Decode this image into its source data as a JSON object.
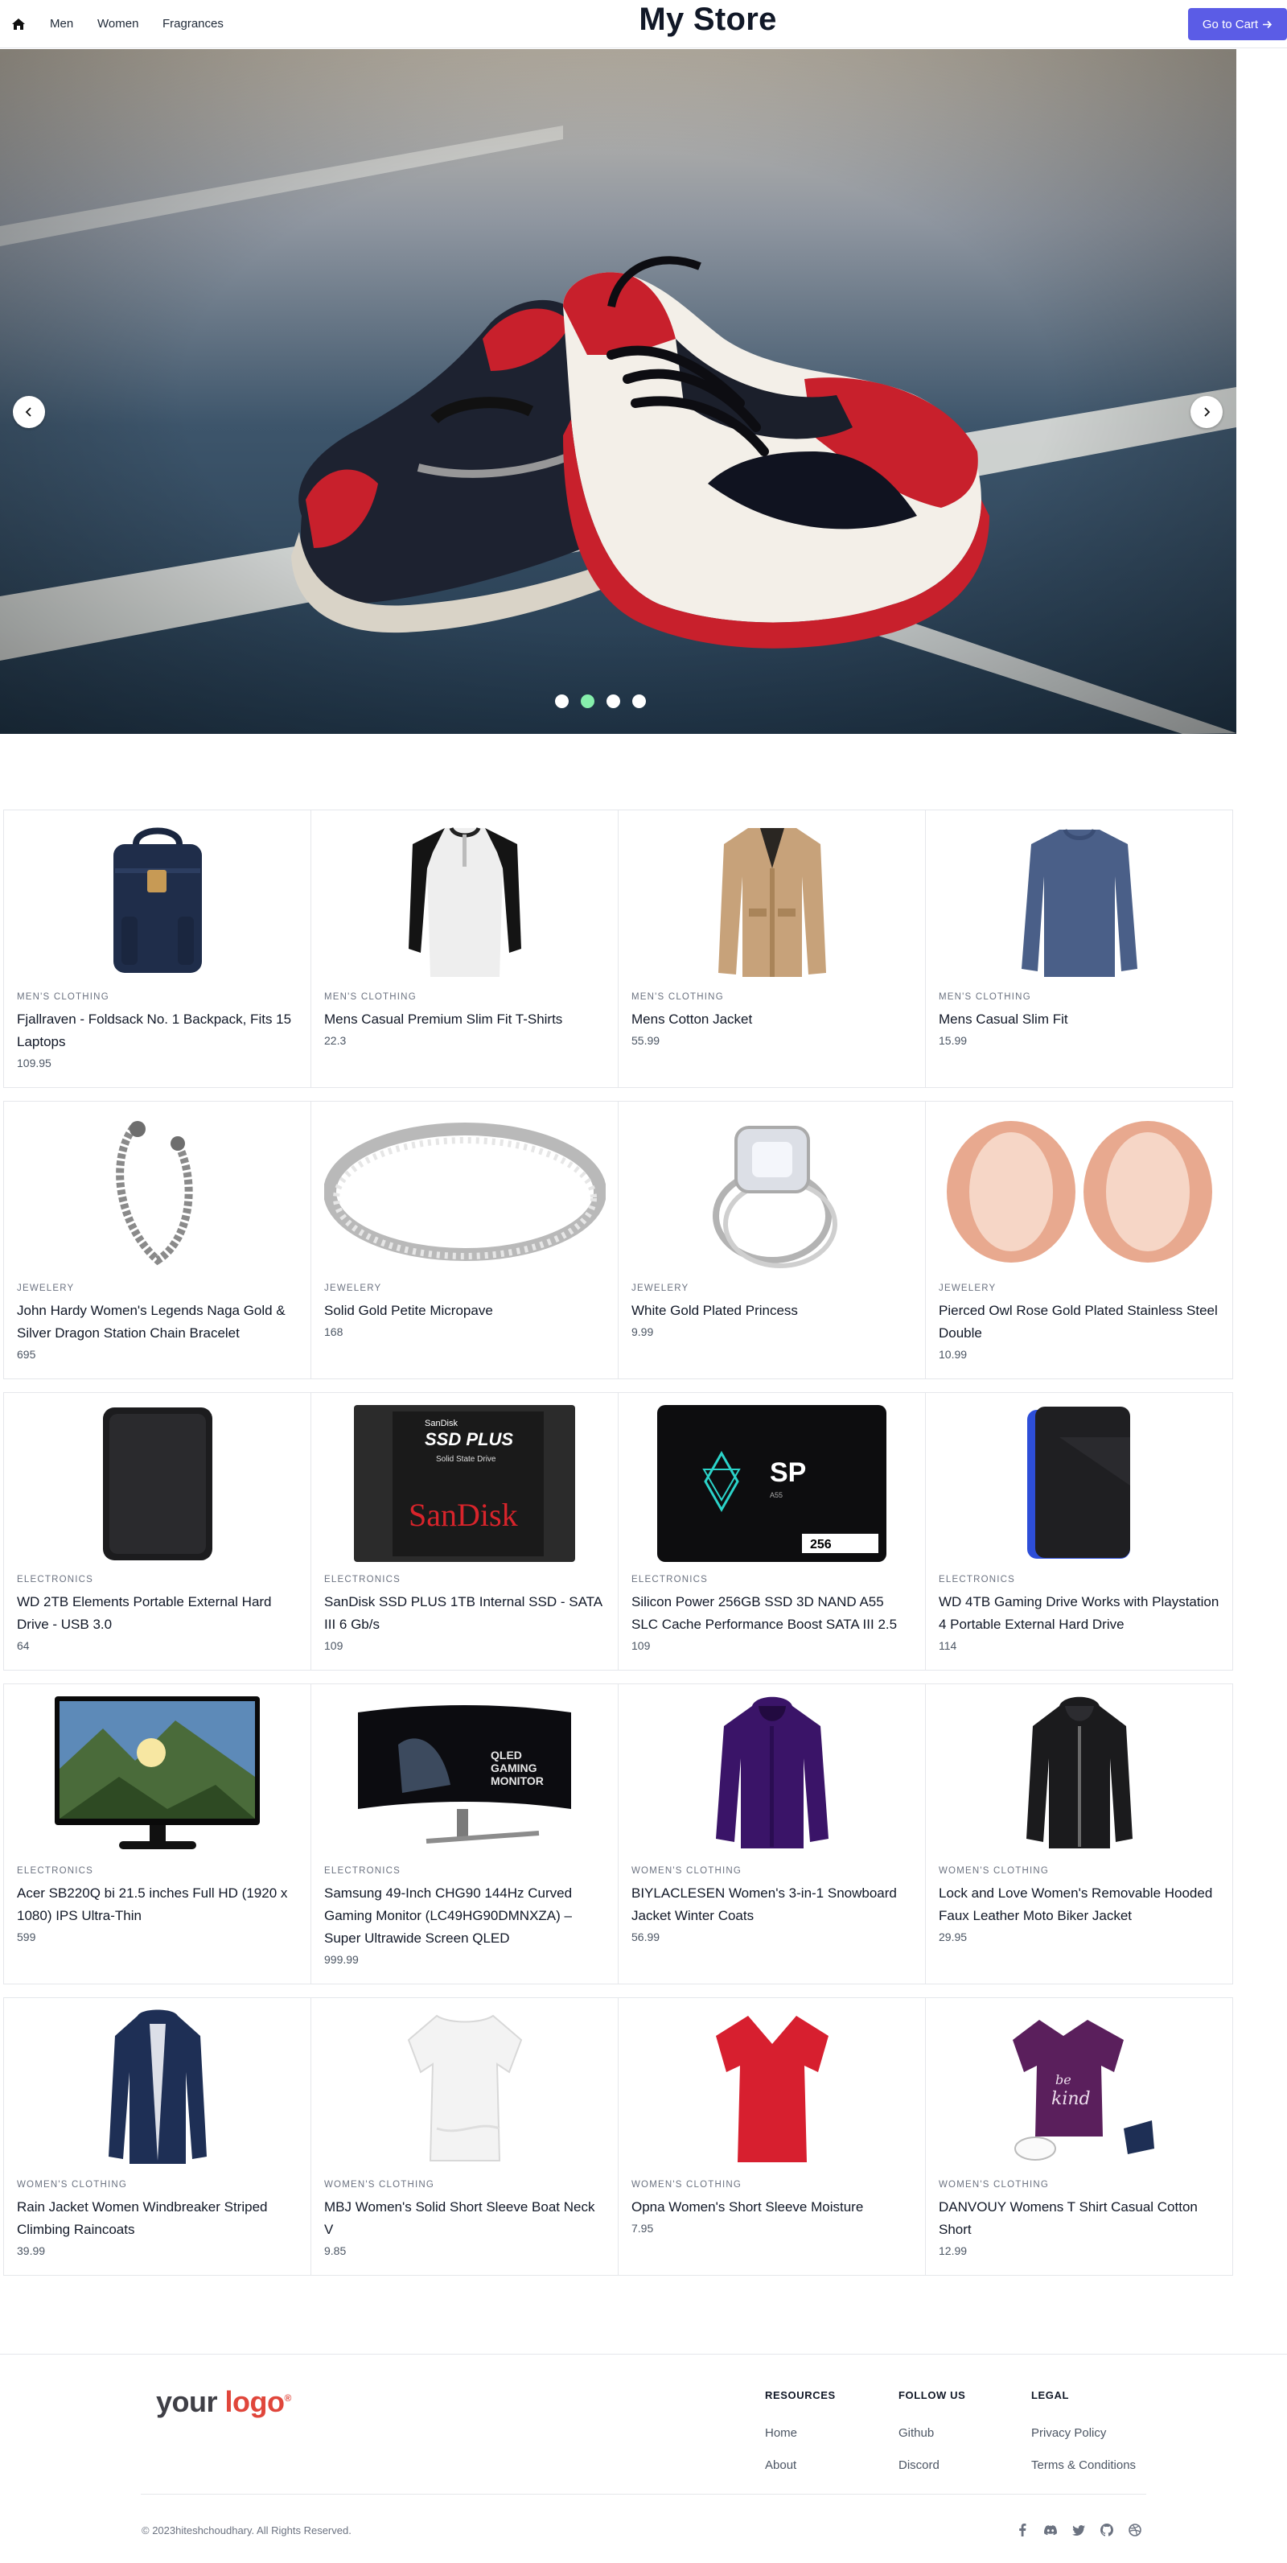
{
  "nav": {
    "home_icon": "home-icon",
    "links": [
      "Men",
      "Women",
      "Fragrances"
    ],
    "title": "My Store",
    "cart_label": "Go to Cart",
    "cart_icon": "arrow-right-icon",
    "accent": "#5b5ce6"
  },
  "hero": {
    "slide_count": 4,
    "active_slide": 2,
    "prev_icon": "chevron-left-icon",
    "next_icon": "chevron-right-icon",
    "active_dot_color": "#86efac"
  },
  "products": [
    {
      "category": "men's clothing",
      "title": "Fjallraven - Foldsack No. 1 Backpack, Fits 15 Laptops",
      "price": "109.95",
      "icon": "backpack"
    },
    {
      "category": "men's clothing",
      "title": "Mens Casual Premium Slim Fit T-Shirts",
      "price": "22.3",
      "icon": "raglan-tshirt"
    },
    {
      "category": "men's clothing",
      "title": "Mens Cotton Jacket",
      "price": "55.99",
      "icon": "cotton-jacket"
    },
    {
      "category": "men's clothing",
      "title": "Mens Casual Slim Fit",
      "price": "15.99",
      "icon": "long-sleeve-shirt"
    },
    {
      "category": "jewelery",
      "title": "John Hardy Women's Legends Naga Gold & Silver Dragon Station Chain Bracelet",
      "price": "695",
      "icon": "chain-bracelet"
    },
    {
      "category": "jewelery",
      "title": "Solid Gold Petite Micropave",
      "price": "168",
      "icon": "pave-ring"
    },
    {
      "category": "jewelery",
      "title": "White Gold Plated Princess",
      "price": "9.99",
      "icon": "princess-ring"
    },
    {
      "category": "jewelery",
      "title": "Pierced Owl Rose Gold Plated Stainless Steel Double",
      "price": "10.99",
      "icon": "rose-gold-tunnels"
    },
    {
      "category": "electronics",
      "title": "WD 2TB Elements Portable External Hard Drive - USB 3.0",
      "price": "64",
      "icon": "external-drive"
    },
    {
      "category": "electronics",
      "title": "SanDisk SSD PLUS 1TB Internal SSD - SATA III 6 Gb/s",
      "price": "109",
      "icon": "sandisk-ssd"
    },
    {
      "category": "electronics",
      "title": "Silicon Power 256GB SSD 3D NAND A55 SLC Cache Performance Boost SATA III 2.5",
      "price": "109",
      "icon": "sp-ssd"
    },
    {
      "category": "electronics",
      "title": "WD 4TB Gaming Drive Works with Playstation 4 Portable External Hard Drive",
      "price": "114",
      "icon": "gaming-drive"
    },
    {
      "category": "electronics",
      "title": "Acer SB220Q bi 21.5 inches Full HD (1920 x 1080) IPS Ultra-Thin",
      "price": "599",
      "icon": "monitor"
    },
    {
      "category": "electronics",
      "title": "Samsung 49-Inch CHG90 144Hz Curved Gaming Monitor (LC49HG90DMNXZA) – Super Ultrawide Screen QLED",
      "price": "999.99",
      "icon": "curved-monitor"
    },
    {
      "category": "women's clothing",
      "title": "BIYLACLESEN Women's 3-in-1 Snowboard Jacket Winter Coats",
      "price": "56.99",
      "icon": "snowboard-jacket"
    },
    {
      "category": "women's clothing",
      "title": "Lock and Love Women's Removable Hooded Faux Leather Moto Biker Jacket",
      "price": "29.95",
      "icon": "leather-jacket"
    },
    {
      "category": "women's clothing",
      "title": "Rain Jacket Women Windbreaker Striped Climbing Raincoats",
      "price": "39.99",
      "icon": "rain-jacket"
    },
    {
      "category": "women's clothing",
      "title": "MBJ Women's Solid Short Sleeve Boat Neck V",
      "price": "9.85",
      "icon": "white-top"
    },
    {
      "category": "women's clothing",
      "title": "Opna Women's Short Sleeve Moisture",
      "price": "7.95",
      "icon": "red-tshirt"
    },
    {
      "category": "women's clothing",
      "title": "DANVOUY Womens T Shirt Casual Cotton Short",
      "price": "12.99",
      "icon": "purple-tshirt"
    }
  ],
  "footer": {
    "logo_text": "your",
    "logo_accent": "logo",
    "logo_reg": "®",
    "columns": [
      {
        "heading": "RESOURCES",
        "links": [
          "Home",
          "About"
        ]
      },
      {
        "heading": "FOLLOW US",
        "links": [
          "Github",
          "Discord"
        ]
      },
      {
        "heading": "LEGAL",
        "links": [
          "Privacy Policy",
          "Terms & Conditions"
        ]
      }
    ],
    "copyright": "© 2023hiteshchoudhary. All Rights Reserved.",
    "social_icons": [
      "facebook-icon",
      "discord-icon",
      "twitter-icon",
      "github-icon",
      "dribbble-icon"
    ]
  }
}
